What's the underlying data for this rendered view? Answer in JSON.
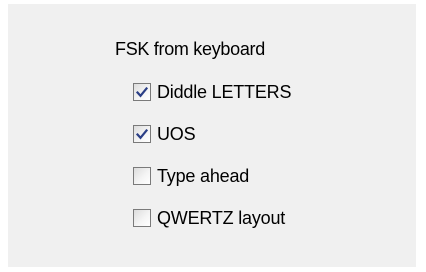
{
  "group": {
    "title": "FSK from keyboard"
  },
  "options": [
    {
      "label": "Diddle LETTERS",
      "checked": true
    },
    {
      "label": "UOS",
      "checked": true
    },
    {
      "label": "Type ahead",
      "checked": false
    },
    {
      "label": "QWERTZ layout",
      "checked": false
    }
  ]
}
